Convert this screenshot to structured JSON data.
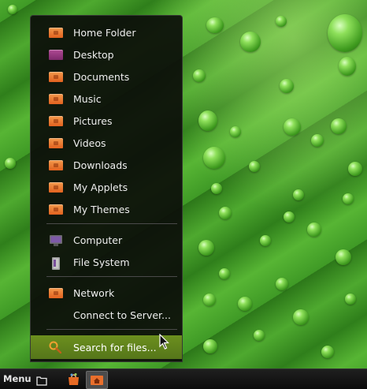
{
  "places_menu": {
    "items": [
      {
        "label": "Home Folder",
        "icon": "home-folder-icon"
      },
      {
        "label": "Desktop",
        "icon": "desktop-folder-icon"
      },
      {
        "label": "Documents",
        "icon": "documents-folder-icon"
      },
      {
        "label": "Music",
        "icon": "music-folder-icon"
      },
      {
        "label": "Pictures",
        "icon": "pictures-folder-icon"
      },
      {
        "label": "Videos",
        "icon": "videos-folder-icon"
      },
      {
        "label": "Downloads",
        "icon": "downloads-folder-icon"
      },
      {
        "label": "My Applets",
        "icon": "folder-icon"
      },
      {
        "label": "My Themes",
        "icon": "folder-icon"
      }
    ],
    "devices": [
      {
        "label": "Computer",
        "icon": "computer-icon"
      },
      {
        "label": "File System",
        "icon": "drive-icon"
      }
    ],
    "network": [
      {
        "label": "Network",
        "icon": "network-folder-icon"
      },
      {
        "label": "Connect to Server...",
        "icon": ""
      }
    ],
    "search": {
      "label": "Search for files...",
      "icon": "search-icon"
    }
  },
  "panel": {
    "menu_label": "Menu"
  },
  "colors": {
    "folder_orange": "#e96f2c",
    "desktop_purple": "#8f3479",
    "highlight_green": "#5f821c",
    "menu_bg": "#0c0e0a"
  }
}
